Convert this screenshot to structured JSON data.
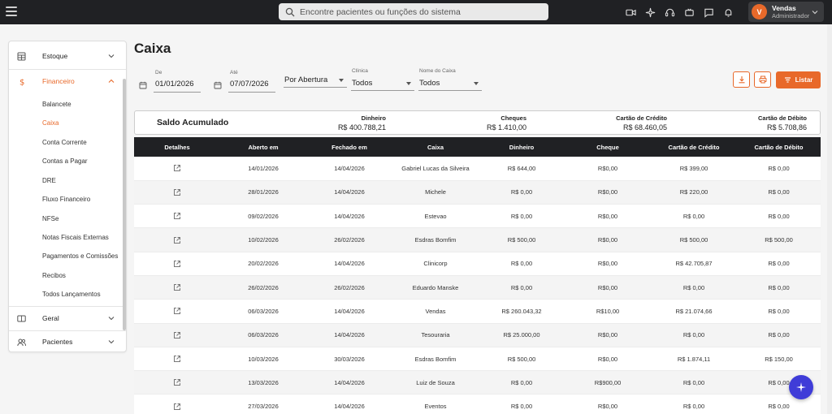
{
  "topbar": {
    "search_placeholder": "Encontre pacientes ou funções do sistema",
    "icons": [
      "video-icon",
      "sparkle-icon",
      "headset-icon",
      "chat-tv-icon",
      "message-icon",
      "bell-icon"
    ],
    "user": {
      "initial": "V",
      "name": "Vendas",
      "role": "Administrador"
    }
  },
  "sidebar": {
    "sections": [
      {
        "label": "Estoque",
        "icon": "calculator-icon"
      },
      {
        "label": "Financeiro",
        "icon": "dollar-icon"
      },
      {
        "label": "Geral",
        "icon": "id-card-icon"
      },
      {
        "label": "Pacientes",
        "icon": "users-icon"
      }
    ],
    "financeiro_items": [
      "Balancete",
      "Caixa",
      "Conta Corrente",
      "Contas a Pagar",
      "DRE",
      "Fluxo Financeiro",
      "NFSe",
      "Notas Fiscais Externas",
      "Pagamentos e Comissões",
      "Recibos",
      "Todos Lançamentos"
    ],
    "active_item": "Caixa"
  },
  "page": {
    "title": "Caixa",
    "filters": {
      "de_label": "De",
      "de_value": "01/01/2026",
      "ate_label": "Até",
      "ate_value": "07/07/2026",
      "tipo_value": "Por Abertura",
      "clinica_label": "Clínica",
      "clinica_value": "Todos",
      "caixa_label": "Nome do Caixa",
      "caixa_value": "Todos"
    },
    "listar_label": "Listar"
  },
  "summary": {
    "title": "Saldo Acumulado",
    "columns": [
      {
        "label": "Dinheiro",
        "value": "R$ 400.788,21"
      },
      {
        "label": "Cheques",
        "value": "R$ 1.410,00"
      },
      {
        "label": "Cartão de Crédito",
        "value": "R$ 68.460,05"
      },
      {
        "label": "Cartão de Débito",
        "value": "R$ 5.708,86"
      }
    ]
  },
  "table": {
    "headers": [
      "Detalhes",
      "Aberto em",
      "Fechado em",
      "Caixa",
      "Dinheiro",
      "Cheque",
      "Cartão de Crédito",
      "Cartão de Débito"
    ],
    "rows": [
      [
        "14/01/2026",
        "14/04/2026",
        "Gabriel Lucas da Silveira",
        "R$ 644,00",
        "R$0,00",
        "R$ 399,00",
        "R$ 0,00"
      ],
      [
        "28/01/2026",
        "14/04/2026",
        "Michele",
        "R$ 0,00",
        "R$0,00",
        "R$ 220,00",
        "R$ 0,00"
      ],
      [
        "09/02/2026",
        "14/04/2026",
        "Estevao",
        "R$ 0,00",
        "R$0,00",
        "R$ 0,00",
        "R$ 0,00"
      ],
      [
        "10/02/2026",
        "26/02/2026",
        "Esdras Bomfim",
        "R$ 500,00",
        "R$0,00",
        "R$ 500,00",
        "R$ 500,00"
      ],
      [
        "20/02/2026",
        "14/04/2026",
        "Clinicorp",
        "R$ 0,00",
        "R$0,00",
        "R$ 42.705,87",
        "R$ 0,00"
      ],
      [
        "26/02/2026",
        "26/02/2026",
        "Eduardo Manske",
        "R$ 0,00",
        "R$0,00",
        "R$ 0,00",
        "R$ 0,00"
      ],
      [
        "06/03/2026",
        "14/04/2026",
        "Vendas",
        "R$ 260.043,32",
        "R$10,00",
        "R$ 21.074,66",
        "R$ 0,00"
      ],
      [
        "06/03/2026",
        "14/04/2026",
        "Tesouraria",
        "R$ 25.000,00",
        "R$0,00",
        "R$ 0,00",
        "R$ 0,00"
      ],
      [
        "10/03/2026",
        "30/03/2026",
        "Esdras Bomfim",
        "R$ 500,00",
        "R$0,00",
        "R$ 1.874,11",
        "R$ 150,00"
      ],
      [
        "13/03/2026",
        "14/04/2026",
        "Luiz de Souza",
        "R$ 0,00",
        "R$900,00",
        "R$ 0,00",
        "R$ 0,00"
      ],
      [
        "27/03/2026",
        "14/04/2026",
        "Eventos",
        "R$ 0,00",
        "R$0,00",
        "R$ 0,00",
        "R$ 0,00"
      ]
    ]
  },
  "colors": {
    "accent": "#e8692a",
    "topbar": "#202124",
    "table_header": "#202124",
    "fab": "#3f3cd8"
  }
}
